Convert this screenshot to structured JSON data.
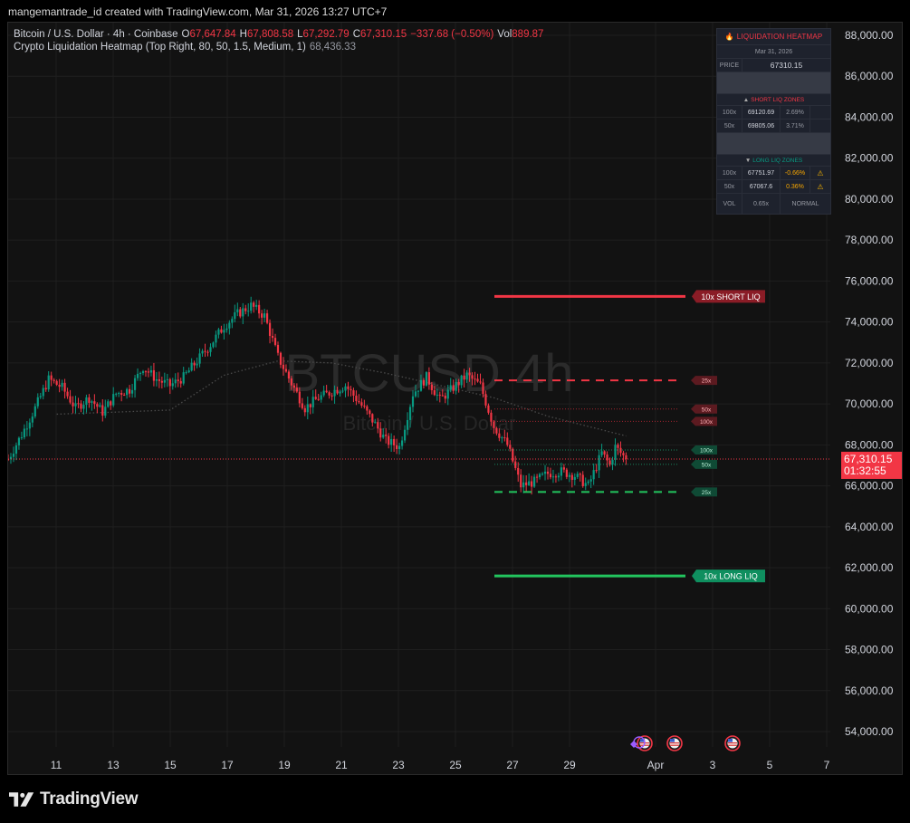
{
  "header": {
    "attribution": "mangemantrade_id created with TradingView.com, Mar 31, 2026 13:27 UTC+7"
  },
  "legend": {
    "symbol_line": "Bitcoin / U.S. Dollar · 4h · Coinbase",
    "o_label": "O",
    "o_value": "67,647.84",
    "h_label": "H",
    "h_value": "67,808.58",
    "l_label": "L",
    "l_value": "67,292.79",
    "c_label": "C",
    "c_value": "67,310.15",
    "change": "−337.68 (−0.50%)",
    "vol_label": "Vol",
    "vol_value": "889.87",
    "indicator": "Crypto Liquidation Heatmap (Top Right, 80, 50, 1.5, Medium, 1)",
    "indicator_value": "68,436.33"
  },
  "watermark": {
    "symbol": "BTCUSD 4h",
    "name": "Bitcoin / U.S. Dollar"
  },
  "liq_table": {
    "title": "LIQUIDATION HEATMAP",
    "flame_icon": "flame-icon",
    "date": "Mar 31, 2026",
    "price_label": "PRICE",
    "price_value": "67310.15",
    "short_title": "SHORT LIQ ZONES",
    "short_rows": [
      {
        "lev": "100x",
        "price": "69120.69",
        "pct": "2.69%"
      },
      {
        "lev": "50x",
        "price": "69805.06",
        "pct": "3.71%"
      }
    ],
    "long_title": "LONG LIQ ZONES",
    "long_rows": [
      {
        "lev": "100x",
        "price": "67751.97",
        "pct": "-0.66%",
        "warn": "⚠"
      },
      {
        "lev": "50x",
        "price": "67067.6",
        "pct": "0.36%",
        "warn": "⚠"
      }
    ],
    "vol_label": "VOL",
    "vol_value": "0.65x",
    "vol_state": "NORMAL",
    "colors": {
      "short": "#f23645",
      "long": "#089981"
    }
  },
  "price_axis": {
    "labels": [
      "88,000.00",
      "86,000.00",
      "84,000.00",
      "82,000.00",
      "80,000.00",
      "78,000.00",
      "76,000.00",
      "74,000.00",
      "72,000.00",
      "70,000.00",
      "68,000.00",
      "66,000.00",
      "64,000.00",
      "62,000.00",
      "60,000.00",
      "58,000.00",
      "56,000.00",
      "54,000.00"
    ],
    "current_price": "67,310.15",
    "countdown": "01:32:55"
  },
  "time_axis": {
    "labels": [
      "11",
      "13",
      "15",
      "17",
      "19",
      "21",
      "23",
      "25",
      "27",
      "29",
      "Apr",
      "3",
      "5",
      "7"
    ]
  },
  "liq_levels": [
    {
      "label": "10x SHORT LIQ",
      "price": 75250,
      "type": "short",
      "style": "solid"
    },
    {
      "label": "25x",
      "price": 71150,
      "type": "short",
      "style": "dashed"
    },
    {
      "label": "50x",
      "price": 69750,
      "type": "short",
      "style": "dotted"
    },
    {
      "label": "100x",
      "price": 69150,
      "type": "short",
      "style": "dotted"
    },
    {
      "label": "100x",
      "price": 67750,
      "type": "long",
      "style": "dotted"
    },
    {
      "label": "50x",
      "price": 67050,
      "type": "long",
      "style": "dotted"
    },
    {
      "label": "25x",
      "price": 65700,
      "type": "long",
      "style": "dashed"
    },
    {
      "label": "10x LONG LIQ",
      "price": 61600,
      "type": "long",
      "style": "solid"
    }
  ],
  "events": [
    {
      "icon": "us-flag-icon"
    },
    {
      "icon": "us-flag-icon"
    },
    {
      "icon": "us-flag-icon"
    }
  ],
  "chart_data": {
    "type": "candlestick",
    "symbol": "BTCUSD",
    "interval": "4h",
    "ylim": [
      53000,
      89000
    ],
    "y_ticks": [
      88000,
      86000,
      84000,
      82000,
      80000,
      78000,
      76000,
      74000,
      72000,
      70000,
      68000,
      66000,
      64000,
      62000,
      60000,
      58000,
      56000,
      54000
    ],
    "x_tick_labels": [
      "11",
      "13",
      "15",
      "17",
      "19",
      "21",
      "23",
      "25",
      "27",
      "29",
      "Apr",
      "3",
      "5",
      "7"
    ],
    "colors": {
      "up": "#089981",
      "down": "#f23645"
    },
    "anchors": [
      {
        "t": 0,
        "p": 67300
      },
      {
        "t": 5,
        "p": 68500
      },
      {
        "t": 10,
        "p": 69800
      },
      {
        "t": 15,
        "p": 71200
      },
      {
        "t": 20,
        "p": 70800
      },
      {
        "t": 25,
        "p": 69800
      },
      {
        "t": 30,
        "p": 70300
      },
      {
        "t": 35,
        "p": 69600
      },
      {
        "t": 40,
        "p": 70500
      },
      {
        "t": 45,
        "p": 70700
      },
      {
        "t": 50,
        "p": 71800
      },
      {
        "t": 55,
        "p": 71200
      },
      {
        "t": 60,
        "p": 70900
      },
      {
        "t": 65,
        "p": 71300
      },
      {
        "t": 70,
        "p": 72100
      },
      {
        "t": 75,
        "p": 72900
      },
      {
        "t": 80,
        "p": 73800
      },
      {
        "t": 85,
        "p": 74400
      },
      {
        "t": 90,
        "p": 74800
      },
      {
        "t": 95,
        "p": 74300
      },
      {
        "t": 100,
        "p": 72300
      },
      {
        "t": 105,
        "p": 71000
      },
      {
        "t": 110,
        "p": 69800
      },
      {
        "t": 115,
        "p": 70300
      },
      {
        "t": 120,
        "p": 70600
      },
      {
        "t": 125,
        "p": 70900
      },
      {
        "t": 130,
        "p": 70100
      },
      {
        "t": 135,
        "p": 69200
      },
      {
        "t": 140,
        "p": 68200
      },
      {
        "t": 145,
        "p": 67900
      },
      {
        "t": 150,
        "p": 70500
      },
      {
        "t": 155,
        "p": 71300
      },
      {
        "t": 160,
        "p": 70200
      },
      {
        "t": 165,
        "p": 70800
      },
      {
        "t": 170,
        "p": 71400
      },
      {
        "t": 175,
        "p": 70900
      },
      {
        "t": 180,
        "p": 68900
      },
      {
        "t": 185,
        "p": 68000
      },
      {
        "t": 190,
        "p": 66000
      },
      {
        "t": 195,
        "p": 66200
      },
      {
        "t": 200,
        "p": 66600
      },
      {
        "t": 205,
        "p": 66700
      },
      {
        "t": 210,
        "p": 66500
      },
      {
        "t": 215,
        "p": 66000
      },
      {
        "t": 220,
        "p": 67600
      },
      {
        "t": 223,
        "p": 67000
      },
      {
        "t": 225,
        "p": 67900
      },
      {
        "t": 229,
        "p": 67310
      }
    ],
    "ma": [
      {
        "t": 18,
        "p": 69500
      },
      {
        "t": 40,
        "p": 69600
      },
      {
        "t": 60,
        "p": 69700
      },
      {
        "t": 80,
        "p": 71400
      },
      {
        "t": 100,
        "p": 72100
      },
      {
        "t": 120,
        "p": 72000
      },
      {
        "t": 140,
        "p": 71500
      },
      {
        "t": 160,
        "p": 70900
      },
      {
        "t": 180,
        "p": 70300
      },
      {
        "t": 200,
        "p": 69400
      },
      {
        "t": 229,
        "p": 68436
      }
    ],
    "last_close": 67310.15
  }
}
